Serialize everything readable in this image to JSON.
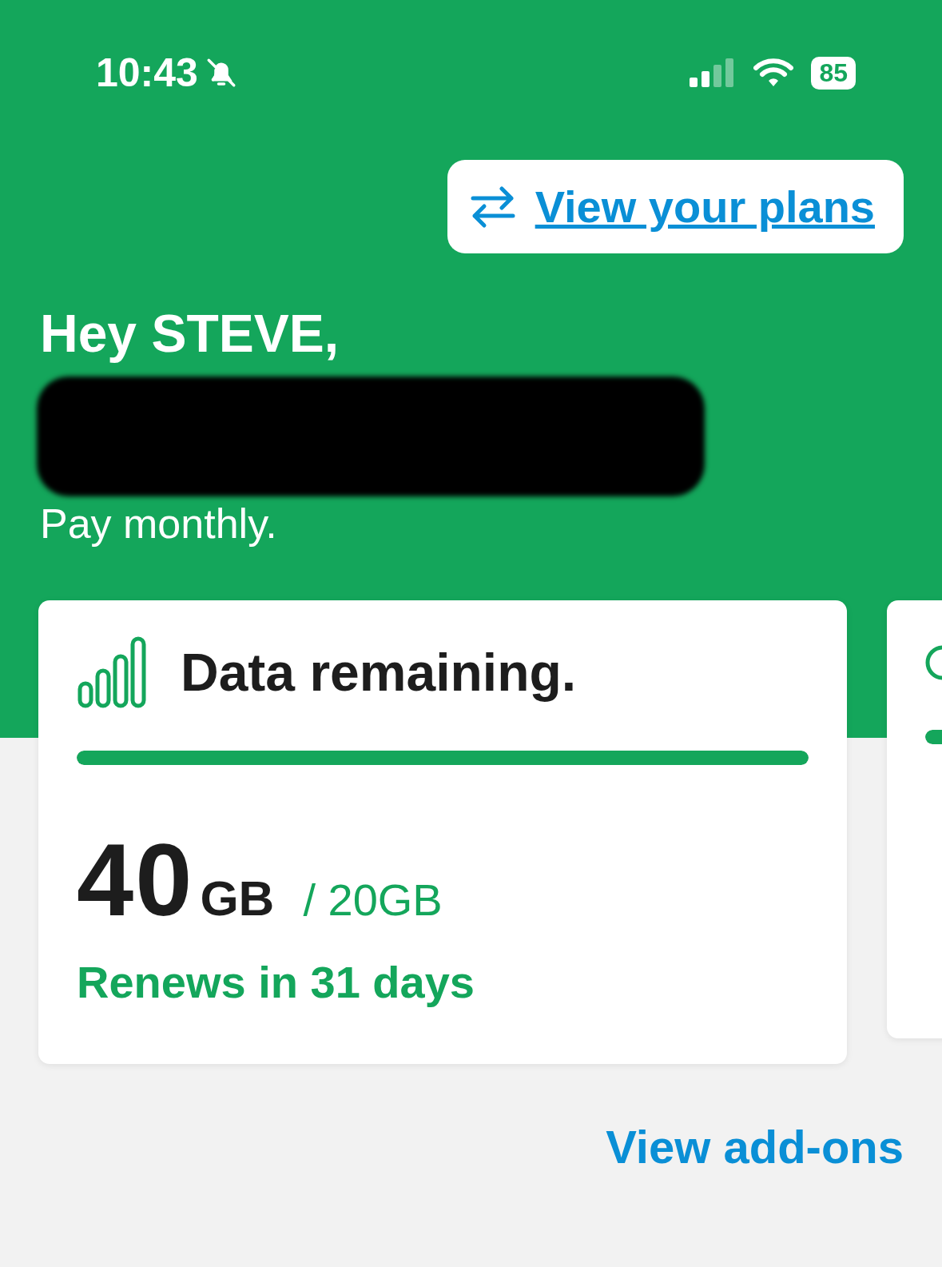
{
  "status_bar": {
    "time": "10:43",
    "silent": true,
    "battery": "85"
  },
  "plans_link": {
    "label": "View your plans"
  },
  "greeting": "Hey STEVE,",
  "plan_type": "Pay monthly.",
  "cards": [
    {
      "kind": "data",
      "title": "Data remaining.",
      "level": 1,
      "amount": "40",
      "unit": "GB",
      "allowance": "/ 20GB",
      "renewal": "Renews in 31 days"
    },
    {
      "kind": "partial",
      "level": 1
    }
  ],
  "addons_link": {
    "label": "View add-ons"
  }
}
